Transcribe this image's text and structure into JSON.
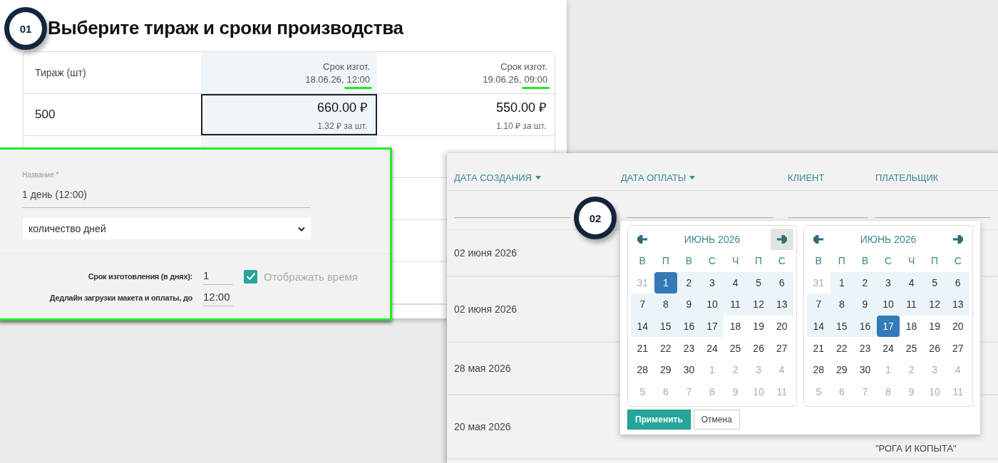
{
  "step_badges": [
    {
      "label": "01"
    },
    {
      "label": "02"
    }
  ],
  "pricing": {
    "title": "Выберите тираж и сроки производства",
    "columns": [
      {
        "label": "Тираж (шт)"
      },
      {
        "label": "Срок изгот.",
        "date": "18.06.26,",
        "time": "12:00",
        "highlighted": true
      },
      {
        "label": "Срок изгот.",
        "date": "19.06.26,",
        "time": "09:00",
        "highlighted": true
      }
    ],
    "rows": [
      {
        "cells": [
          {
            "kind": "quantity",
            "value": "500",
            "selected": false
          },
          {
            "kind": "price",
            "price": "660.00 ₽",
            "unit_price": "1.32 ₽ за шт.",
            "selected": true
          },
          {
            "kind": "price",
            "price": "550.00 ₽",
            "unit_price": "1.10 ₽ за шт.",
            "selected": false
          }
        ]
      }
    ]
  },
  "term_form": {
    "name_label": "Название *",
    "name_value": "1 день (12:00)",
    "type_value": "количество дней",
    "days_label": "Срок изготовления (в днях):",
    "days_value": "1",
    "show_time_label": "Отображать время",
    "show_time_checked": true,
    "deadline_label": "Дедлайн загрузки макета и оплаты, до",
    "deadline_value": "12:00"
  },
  "orders": {
    "columns": [
      {
        "label": "ДАТА СОЗДАНИЯ",
        "sortable": true
      },
      {
        "label": "ДАТА ОПЛАТЫ",
        "sortable": true
      },
      {
        "label": "КЛИЕНТ",
        "sortable": false
      },
      {
        "label": "ПЛАТЕЛЬЩИК",
        "sortable": false
      }
    ],
    "rows": [
      {
        "created": "02 июня 2026"
      },
      {
        "created": "02 июня 2026"
      },
      {
        "created": "28 мая 2026"
      },
      {
        "created": "20 мая 2026",
        "payer": "\"РОГА И КОПЫТА\""
      }
    ]
  },
  "date_picker": {
    "calendars": [
      {
        "month": "ИЮНЬ 2026",
        "next_hover": true,
        "weekdays": [
          "В",
          "П",
          "В",
          "С",
          "Ч",
          "П",
          "С"
        ],
        "weeks": [
          [
            {
              "d": "31",
              "muted": true,
              "in_range": false,
              "selected": false
            },
            {
              "d": "1",
              "muted": false,
              "in_range": true,
              "selected": true
            },
            {
              "d": "2",
              "muted": false,
              "in_range": true,
              "selected": false
            },
            {
              "d": "3",
              "muted": false,
              "in_range": true,
              "selected": false
            },
            {
              "d": "4",
              "muted": false,
              "in_range": true,
              "selected": false
            },
            {
              "d": "5",
              "muted": false,
              "in_range": true,
              "selected": false
            },
            {
              "d": "6",
              "muted": false,
              "in_range": true,
              "selected": false
            }
          ],
          [
            {
              "d": "7",
              "muted": false,
              "in_range": true,
              "selected": false
            },
            {
              "d": "8",
              "muted": false,
              "in_range": true,
              "selected": false
            },
            {
              "d": "9",
              "muted": false,
              "in_range": true,
              "selected": false
            },
            {
              "d": "10",
              "muted": false,
              "in_range": true,
              "selected": false
            },
            {
              "d": "11",
              "muted": false,
              "in_range": true,
              "selected": false
            },
            {
              "d": "12",
              "muted": false,
              "in_range": true,
              "selected": false
            },
            {
              "d": "13",
              "muted": false,
              "in_range": true,
              "selected": false
            }
          ],
          [
            {
              "d": "14",
              "muted": false,
              "in_range": true,
              "selected": false
            },
            {
              "d": "15",
              "muted": false,
              "in_range": true,
              "selected": false
            },
            {
              "d": "16",
              "muted": false,
              "in_range": true,
              "selected": false
            },
            {
              "d": "17",
              "muted": false,
              "in_range": true,
              "selected": false
            },
            {
              "d": "18",
              "muted": false,
              "in_range": false,
              "selected": false
            },
            {
              "d": "19",
              "muted": false,
              "in_range": false,
              "selected": false
            },
            {
              "d": "20",
              "muted": false,
              "in_range": false,
              "selected": false
            }
          ],
          [
            {
              "d": "21",
              "muted": false,
              "in_range": false,
              "selected": false
            },
            {
              "d": "22",
              "muted": false,
              "in_range": false,
              "selected": false
            },
            {
              "d": "23",
              "muted": false,
              "in_range": false,
              "selected": false
            },
            {
              "d": "24",
              "muted": false,
              "in_range": false,
              "selected": false
            },
            {
              "d": "25",
              "muted": false,
              "in_range": false,
              "selected": false
            },
            {
              "d": "26",
              "muted": false,
              "in_range": false,
              "selected": false
            },
            {
              "d": "27",
              "muted": false,
              "in_range": false,
              "selected": false
            }
          ],
          [
            {
              "d": "28",
              "muted": false,
              "in_range": false,
              "selected": false
            },
            {
              "d": "29",
              "muted": false,
              "in_range": false,
              "selected": false
            },
            {
              "d": "30",
              "muted": false,
              "in_range": false,
              "selected": false
            },
            {
              "d": "1",
              "muted": true,
              "in_range": false,
              "selected": false
            },
            {
              "d": "2",
              "muted": true,
              "in_range": false,
              "selected": false
            },
            {
              "d": "3",
              "muted": true,
              "in_range": false,
              "selected": false
            },
            {
              "d": "4",
              "muted": true,
              "in_range": false,
              "selected": false
            }
          ],
          [
            {
              "d": "5",
              "muted": true,
              "in_range": false,
              "selected": false
            },
            {
              "d": "6",
              "muted": true,
              "in_range": false,
              "selected": false
            },
            {
              "d": "7",
              "muted": true,
              "in_range": false,
              "selected": false
            },
            {
              "d": "8",
              "muted": true,
              "in_range": false,
              "selected": false
            },
            {
              "d": "9",
              "muted": true,
              "in_range": false,
              "selected": false
            },
            {
              "d": "10",
              "muted": true,
              "in_range": false,
              "selected": false
            },
            {
              "d": "11",
              "muted": true,
              "in_range": false,
              "selected": false
            }
          ]
        ]
      },
      {
        "month": "ИЮНЬ 2026",
        "next_hover": false,
        "weekdays": [
          "В",
          "П",
          "В",
          "С",
          "Ч",
          "П",
          "С"
        ],
        "weeks": [
          [
            {
              "d": "31",
              "muted": true,
              "in_range": false,
              "selected": false
            },
            {
              "d": "1",
              "muted": false,
              "in_range": true,
              "selected": false
            },
            {
              "d": "2",
              "muted": false,
              "in_range": true,
              "selected": false
            },
            {
              "d": "3",
              "muted": false,
              "in_range": true,
              "selected": false
            },
            {
              "d": "4",
              "muted": false,
              "in_range": true,
              "selected": false
            },
            {
              "d": "5",
              "muted": false,
              "in_range": true,
              "selected": false
            },
            {
              "d": "6",
              "muted": false,
              "in_range": true,
              "selected": false
            }
          ],
          [
            {
              "d": "7",
              "muted": false,
              "in_range": true,
              "selected": false
            },
            {
              "d": "8",
              "muted": false,
              "in_range": true,
              "selected": false
            },
            {
              "d": "9",
              "muted": false,
              "in_range": true,
              "selected": false
            },
            {
              "d": "10",
              "muted": false,
              "in_range": true,
              "selected": false
            },
            {
              "d": "11",
              "muted": false,
              "in_range": true,
              "selected": false
            },
            {
              "d": "12",
              "muted": false,
              "in_range": true,
              "selected": false
            },
            {
              "d": "13",
              "muted": false,
              "in_range": true,
              "selected": false
            }
          ],
          [
            {
              "d": "14",
              "muted": false,
              "in_range": true,
              "selected": false
            },
            {
              "d": "15",
              "muted": false,
              "in_range": true,
              "selected": false
            },
            {
              "d": "16",
              "muted": false,
              "in_range": true,
              "selected": false
            },
            {
              "d": "17",
              "muted": false,
              "in_range": true,
              "selected": true
            },
            {
              "d": "18",
              "muted": false,
              "in_range": false,
              "selected": false
            },
            {
              "d": "19",
              "muted": false,
              "in_range": false,
              "selected": false
            },
            {
              "d": "20",
              "muted": false,
              "in_range": false,
              "selected": false
            }
          ],
          [
            {
              "d": "21",
              "muted": false,
              "in_range": false,
              "selected": false
            },
            {
              "d": "22",
              "muted": false,
              "in_range": false,
              "selected": false
            },
            {
              "d": "23",
              "muted": false,
              "in_range": false,
              "selected": false
            },
            {
              "d": "24",
              "muted": false,
              "in_range": false,
              "selected": false
            },
            {
              "d": "25",
              "muted": false,
              "in_range": false,
              "selected": false
            },
            {
              "d": "26",
              "muted": false,
              "in_range": false,
              "selected": false
            },
            {
              "d": "27",
              "muted": false,
              "in_range": false,
              "selected": false
            }
          ],
          [
            {
              "d": "28",
              "muted": false,
              "in_range": false,
              "selected": false
            },
            {
              "d": "29",
              "muted": false,
              "in_range": false,
              "selected": false
            },
            {
              "d": "30",
              "muted": false,
              "in_range": false,
              "selected": false
            },
            {
              "d": "1",
              "muted": true,
              "in_range": false,
              "selected": false
            },
            {
              "d": "2",
              "muted": true,
              "in_range": false,
              "selected": false
            },
            {
              "d": "3",
              "muted": true,
              "in_range": false,
              "selected": false
            },
            {
              "d": "4",
              "muted": true,
              "in_range": false,
              "selected": false
            }
          ],
          [
            {
              "d": "5",
              "muted": true,
              "in_range": false,
              "selected": false
            },
            {
              "d": "6",
              "muted": true,
              "in_range": false,
              "selected": false
            },
            {
              "d": "7",
              "muted": true,
              "in_range": false,
              "selected": false
            },
            {
              "d": "8",
              "muted": true,
              "in_range": false,
              "selected": false
            },
            {
              "d": "9",
              "muted": true,
              "in_range": false,
              "selected": false
            },
            {
              "d": "10",
              "muted": true,
              "in_range": false,
              "selected": false
            },
            {
              "d": "11",
              "muted": true,
              "in_range": false,
              "selected": false
            }
          ]
        ]
      }
    ],
    "apply_label": "Применить",
    "cancel_label": "Отмена"
  }
}
